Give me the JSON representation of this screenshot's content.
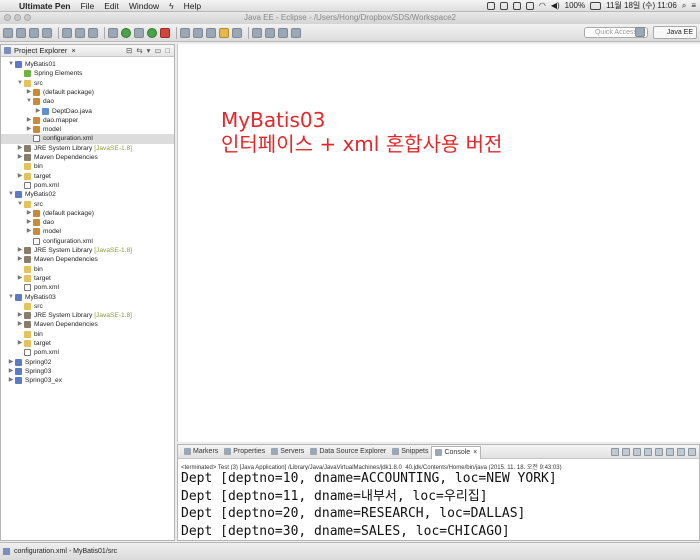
{
  "menubar": {
    "app": "Ultimate Pen",
    "items": [
      "File",
      "Edit",
      "Window",
      "Help"
    ],
    "battery": "100%",
    "datetime": "11월 18일 (수)  11:06"
  },
  "window": {
    "title": "Java EE - Eclipse - /Users/Hong/Dropbox/SDS/Workspace2"
  },
  "toolbar": {
    "quick_access": "Quick Access",
    "perspective": "Java EE"
  },
  "explorer": {
    "title": "Project Explorer",
    "rows": [
      {
        "label": "MyBatis01",
        "indent": 0,
        "arrow": "▼",
        "icon": "project",
        "icon_name": "project-icon"
      },
      {
        "label": "Spring Elements",
        "indent": 1,
        "arrow": "",
        "icon": "spring",
        "icon_name": "spring-elements-icon"
      },
      {
        "label": "src",
        "indent": 1,
        "arrow": "▼",
        "icon": "folder",
        "icon_name": "source-folder-icon"
      },
      {
        "label": "(default package)",
        "indent": 2,
        "arrow": "▶",
        "icon": "pkg",
        "icon_name": "package-icon"
      },
      {
        "label": "dao",
        "indent": 2,
        "arrow": "▼",
        "icon": "pkg",
        "icon_name": "package-icon"
      },
      {
        "label": "DeptDao.java",
        "indent": 3,
        "arrow": "▶",
        "icon": "java",
        "icon_name": "java-file-icon"
      },
      {
        "label": "dao.mapper",
        "indent": 2,
        "arrow": "▶",
        "icon": "pkg",
        "icon_name": "package-icon"
      },
      {
        "label": "model",
        "indent": 2,
        "arrow": "▶",
        "icon": "pkg",
        "icon_name": "package-icon"
      },
      {
        "label": "configuration.xml",
        "indent": 2,
        "arrow": "",
        "icon": "xml",
        "icon_name": "xml-file-icon",
        "selected": true
      },
      {
        "label": "JRE System Library",
        "tag": "[JavaSE-1.8]",
        "indent": 1,
        "arrow": "▶",
        "icon": "lib",
        "icon_name": "library-icon"
      },
      {
        "label": "Maven Dependencies",
        "indent": 1,
        "arrow": "▶",
        "icon": "lib",
        "icon_name": "library-icon"
      },
      {
        "label": "bin",
        "indent": 1,
        "arrow": "",
        "icon": "folder",
        "icon_name": "folder-icon"
      },
      {
        "label": "target",
        "indent": 1,
        "arrow": "▶",
        "icon": "folder",
        "icon_name": "folder-icon"
      },
      {
        "label": "pom.xml",
        "indent": 1,
        "arrow": "",
        "icon": "xml",
        "icon_name": "xml-file-icon"
      },
      {
        "label": "MyBatis02",
        "indent": 0,
        "arrow": "▼",
        "icon": "project",
        "icon_name": "project-icon"
      },
      {
        "label": "src",
        "indent": 1,
        "arrow": "▼",
        "icon": "folder",
        "icon_name": "source-folder-icon"
      },
      {
        "label": "(default package)",
        "indent": 2,
        "arrow": "▶",
        "icon": "pkg",
        "icon_name": "package-icon"
      },
      {
        "label": "dao",
        "indent": 2,
        "arrow": "▶",
        "icon": "pkg",
        "icon_name": "package-icon"
      },
      {
        "label": "model",
        "indent": 2,
        "arrow": "▶",
        "icon": "pkg",
        "icon_name": "package-icon"
      },
      {
        "label": "configuration.xml",
        "indent": 2,
        "arrow": "",
        "icon": "xml",
        "icon_name": "xml-file-icon"
      },
      {
        "label": "JRE System Library",
        "tag": "[JavaSE-1.8]",
        "indent": 1,
        "arrow": "▶",
        "icon": "lib",
        "icon_name": "library-icon"
      },
      {
        "label": "Maven Dependencies",
        "indent": 1,
        "arrow": "▶",
        "icon": "lib",
        "icon_name": "library-icon"
      },
      {
        "label": "bin",
        "indent": 1,
        "arrow": "",
        "icon": "folder",
        "icon_name": "folder-icon"
      },
      {
        "label": "target",
        "indent": 1,
        "arrow": "▶",
        "icon": "folder",
        "icon_name": "folder-icon"
      },
      {
        "label": "pom.xml",
        "indent": 1,
        "arrow": "",
        "icon": "xml",
        "icon_name": "xml-file-icon"
      },
      {
        "label": "MyBatis03",
        "indent": 0,
        "arrow": "▼",
        "icon": "project",
        "icon_name": "project-icon"
      },
      {
        "label": "src",
        "indent": 1,
        "arrow": "",
        "icon": "folder",
        "icon_name": "source-folder-icon"
      },
      {
        "label": "JRE System Library",
        "tag": "[JavaSE-1.8]",
        "indent": 1,
        "arrow": "▶",
        "icon": "lib",
        "icon_name": "library-icon"
      },
      {
        "label": "Maven Dependencies",
        "indent": 1,
        "arrow": "▶",
        "icon": "lib",
        "icon_name": "library-icon"
      },
      {
        "label": "bin",
        "indent": 1,
        "arrow": "",
        "icon": "folder",
        "icon_name": "folder-icon"
      },
      {
        "label": "target",
        "indent": 1,
        "arrow": "▶",
        "icon": "folder",
        "icon_name": "folder-icon"
      },
      {
        "label": "pom.xml",
        "indent": 1,
        "arrow": "",
        "icon": "xml",
        "icon_name": "xml-file-icon"
      },
      {
        "label": "Spring02",
        "indent": 0,
        "arrow": "▶",
        "icon": "project",
        "icon_name": "project-icon"
      },
      {
        "label": "Spring03",
        "indent": 0,
        "arrow": "▶",
        "icon": "project",
        "icon_name": "project-icon"
      },
      {
        "label": "Spring03_ex",
        "indent": 0,
        "arrow": "▶",
        "icon": "project",
        "icon_name": "project-icon"
      }
    ]
  },
  "editor": {
    "headline_1": "MyBatis03",
    "headline_2": "인터페이스 + xml 혼합사용 버전",
    "headline_color": "#e6262b"
  },
  "console": {
    "tabs": [
      "Markers",
      "Properties",
      "Servers",
      "Data Source Explorer",
      "Snippets",
      "Console"
    ],
    "active_tab": "Console",
    "terminated": "<terminated> Test (3) [Java Application] /Library/Java/JavaVirtualMachines/jdk1.8.0_40.jdk/Contents/Home/bin/java (2015. 11. 18. 오전 9:43:03)",
    "lines": [
      "Dept [deptno=10, dname=ACCOUNTING, loc=NEW YORK]",
      "Dept [deptno=11, dname=내부서, loc=우리집]",
      "Dept [deptno=20, dname=RESEARCH, loc=DALLAS]",
      "Dept [deptno=30, dname=SALES, loc=CHICAGO]"
    ]
  },
  "status": {
    "text": "configuration.xml - MyBatis01/src"
  }
}
